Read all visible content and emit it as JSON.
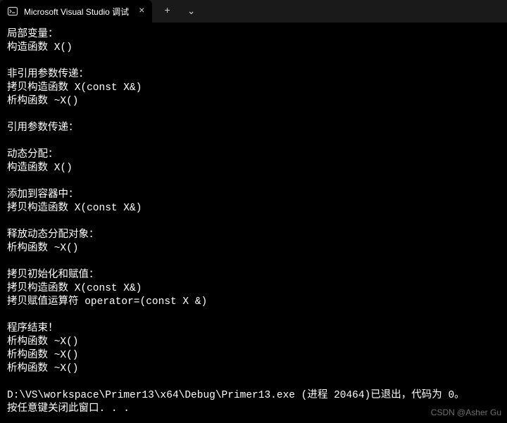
{
  "titlebar": {
    "tab": {
      "icon_name": "terminal-icon",
      "title": "Microsoft Visual Studio 调试",
      "close_label": "×"
    },
    "new_tab_label": "+",
    "dropdown_label": "⌄"
  },
  "terminal": {
    "lines": [
      "局部变量：",
      "构造函数 X()",
      "",
      "非引用参数传递：",
      "拷贝构造函数 X(const X&)",
      "析构函数 ~X()",
      "",
      "引用参数传递：",
      "",
      "动态分配：",
      "构造函数 X()",
      "",
      "添加到容器中：",
      "拷贝构造函数 X(const X&)",
      "",
      "释放动态分配对象：",
      "析构函数 ~X()",
      "",
      "拷贝初始化和赋值：",
      "拷贝构造函数 X(const X&)",
      "拷贝赋值运算符 operator=(const X &)",
      "",
      "程序结束！",
      "析构函数 ~X()",
      "析构函数 ~X()",
      "析构函数 ~X()",
      "",
      "D:\\VS\\workspace\\Primer13\\x64\\Debug\\Primer13.exe (进程 20464)已退出，代码为 0。",
      "按任意键关闭此窗口. . ."
    ]
  },
  "watermark": "CSDN @Asher Gu"
}
